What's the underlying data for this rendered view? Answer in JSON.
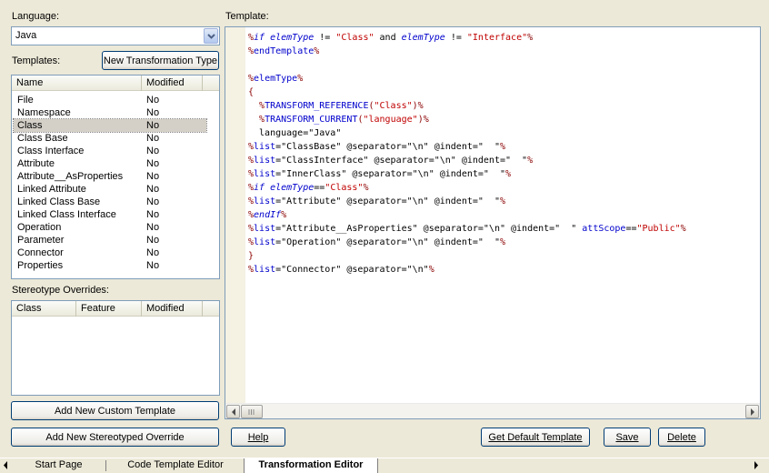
{
  "language": {
    "label": "Language:",
    "value": "Java"
  },
  "templates": {
    "label": "Templates:",
    "new_button": "New Transformation Type",
    "columns": [
      "Name",
      "Modified"
    ],
    "rows": [
      {
        "name": "File",
        "modified": "No"
      },
      {
        "name": "Namespace",
        "modified": "No"
      },
      {
        "name": "Class",
        "modified": "No",
        "selected": true
      },
      {
        "name": "Class Base",
        "modified": "No"
      },
      {
        "name": "Class Interface",
        "modified": "No"
      },
      {
        "name": "Attribute",
        "modified": "No"
      },
      {
        "name": "Attribute__AsProperties",
        "modified": "No"
      },
      {
        "name": "Linked Attribute",
        "modified": "No"
      },
      {
        "name": "Linked Class Base",
        "modified": "No"
      },
      {
        "name": "Linked Class Interface",
        "modified": "No"
      },
      {
        "name": "Operation",
        "modified": "No"
      },
      {
        "name": "Parameter",
        "modified": "No"
      },
      {
        "name": "Connector",
        "modified": "No"
      },
      {
        "name": "Properties",
        "modified": "No"
      }
    ]
  },
  "stereotype": {
    "label": "Stereotype Overrides:",
    "columns": [
      "Class",
      "Feature",
      "Modified"
    ]
  },
  "buttons": {
    "add_custom": "Add New Custom Template",
    "add_stereotyped": "Add New Stereotyped Override",
    "help": "Help",
    "get_default": "Get Default Template",
    "save": "Save",
    "delete": "Delete"
  },
  "template": {
    "label": "Template:",
    "lines": [
      [
        [
          "p",
          "%"
        ],
        [
          "k",
          "if elemType"
        ],
        [
          "t",
          " != "
        ],
        [
          "s",
          "\"Class\""
        ],
        [
          "t",
          " and "
        ],
        [
          "k",
          "elemType"
        ],
        [
          "t",
          " != "
        ],
        [
          "s",
          "\"Interface\""
        ],
        [
          "p",
          "%"
        ]
      ],
      [
        [
          "p",
          "%"
        ],
        [
          "m",
          "endTemplate"
        ],
        [
          "p",
          "%"
        ]
      ],
      [],
      [
        [
          "p",
          "%"
        ],
        [
          "m",
          "elemType"
        ],
        [
          "p",
          "%"
        ]
      ],
      [
        [
          "p",
          "{"
        ]
      ],
      [
        [
          "t",
          "  "
        ],
        [
          "p",
          "%"
        ],
        [
          "m",
          "TRANSFORM_REFERENCE"
        ],
        [
          "p",
          "("
        ],
        [
          "s",
          "\"Class\""
        ],
        [
          "p",
          ")%"
        ]
      ],
      [
        [
          "t",
          "  "
        ],
        [
          "p",
          "%"
        ],
        [
          "m",
          "TRANSFORM_CURRENT"
        ],
        [
          "p",
          "("
        ],
        [
          "s",
          "\"language\""
        ],
        [
          "p",
          ")%"
        ]
      ],
      [
        [
          "t",
          "  language=\"Java\""
        ]
      ],
      [
        [
          "p",
          "%"
        ],
        [
          "m",
          "list"
        ],
        [
          "t",
          "=\"ClassBase\" @separator=\"\\n\" @indent=\"  \""
        ],
        [
          "p",
          "%"
        ]
      ],
      [
        [
          "p",
          "%"
        ],
        [
          "m",
          "list"
        ],
        [
          "t",
          "=\"ClassInterface\" @separator=\"\\n\" @indent=\"  \""
        ],
        [
          "p",
          "%"
        ]
      ],
      [
        [
          "p",
          "%"
        ],
        [
          "m",
          "list"
        ],
        [
          "t",
          "=\"InnerClass\" @separator=\"\\n\" @indent=\"  \""
        ],
        [
          "p",
          "%"
        ]
      ],
      [
        [
          "p",
          "%"
        ],
        [
          "k",
          "if elemType"
        ],
        [
          "t",
          "=="
        ],
        [
          "s",
          "\"Class\""
        ],
        [
          "p",
          "%"
        ]
      ],
      [
        [
          "p",
          "%"
        ],
        [
          "m",
          "list"
        ],
        [
          "t",
          "=\"Attribute\" @separator=\"\\n\" @indent=\"  \""
        ],
        [
          "p",
          "%"
        ]
      ],
      [
        [
          "p",
          "%"
        ],
        [
          "k",
          "endIf"
        ],
        [
          "p",
          "%"
        ]
      ],
      [
        [
          "p",
          "%"
        ],
        [
          "m",
          "list"
        ],
        [
          "t",
          "=\"Attribute__AsProperties\" @separator=\"\\n\" @indent=\"  \" "
        ],
        [
          "m",
          "attScope"
        ],
        [
          "t",
          "=="
        ],
        [
          "s",
          "\"Public\""
        ],
        [
          "p",
          "%"
        ]
      ],
      [
        [
          "p",
          "%"
        ],
        [
          "m",
          "list"
        ],
        [
          "t",
          "=\"Operation\" @separator=\"\\n\" @indent=\"  \""
        ],
        [
          "p",
          "%"
        ]
      ],
      [
        [
          "p",
          "}"
        ]
      ],
      [
        [
          "p",
          "%"
        ],
        [
          "m",
          "list"
        ],
        [
          "t",
          "=\"Connector\" @separator=\"\\n\""
        ],
        [
          "p",
          "%"
        ]
      ]
    ]
  },
  "tabs": [
    "Start Page",
    "Code Template Editor",
    "Transformation Editor"
  ],
  "icons": {
    "dropdown": "chevron-down-icon",
    "scroll_left": "arrow-left-icon",
    "scroll_right": "arrow-right-icon",
    "tab_prev": "arrow-left-icon",
    "tab_next": "arrow-right-icon"
  },
  "colors": {
    "window_bg": "#ece9d8",
    "field_border": "#7f9db9",
    "button_border": "#003c74",
    "keyword": "#0000cc",
    "string": "#c00000",
    "percent": "#8b0000",
    "gutter": "#f5f1e3"
  }
}
